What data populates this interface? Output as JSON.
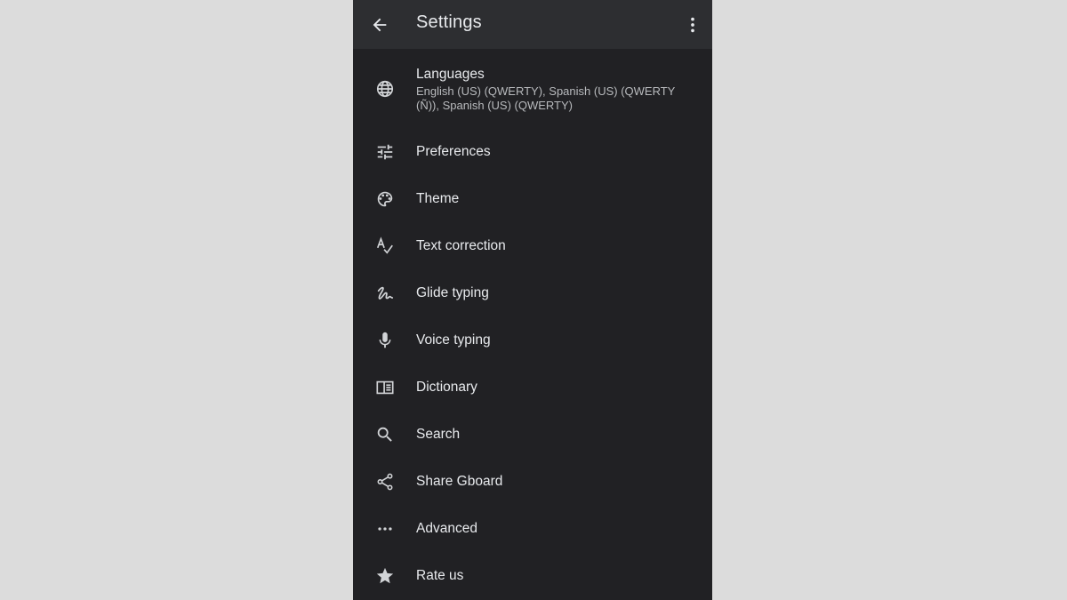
{
  "appbar": {
    "title": "Settings",
    "back_icon": "arrow-back-icon",
    "more_icon": "more-vert-icon"
  },
  "settings": {
    "languages": {
      "label": "Languages",
      "summary": "English (US) (QWERTY), Spanish (US) (QWERTY (Ñ)), Spanish (US) (QWERTY)",
      "icon": "globe-icon"
    },
    "items": [
      {
        "label": "Preferences",
        "icon": "tune-icon"
      },
      {
        "label": "Theme",
        "icon": "palette-icon"
      },
      {
        "label": "Text correction",
        "icon": "spellcheck-icon"
      },
      {
        "label": "Glide typing",
        "icon": "gesture-icon"
      },
      {
        "label": "Voice typing",
        "icon": "mic-icon"
      },
      {
        "label": "Dictionary",
        "icon": "book-icon"
      },
      {
        "label": "Search",
        "icon": "search-icon"
      },
      {
        "label": "Share Gboard",
        "icon": "share-icon"
      },
      {
        "label": "Advanced",
        "icon": "more-horiz-icon"
      },
      {
        "label": "Rate us",
        "icon": "star-icon"
      }
    ]
  },
  "colors": {
    "background": "#212124",
    "appbar": "#2d2e31",
    "text_primary": "#e8eaed",
    "text_secondary": "#b8babd",
    "icon": "#d2d4d7",
    "page_background": "#dcdcdc"
  }
}
